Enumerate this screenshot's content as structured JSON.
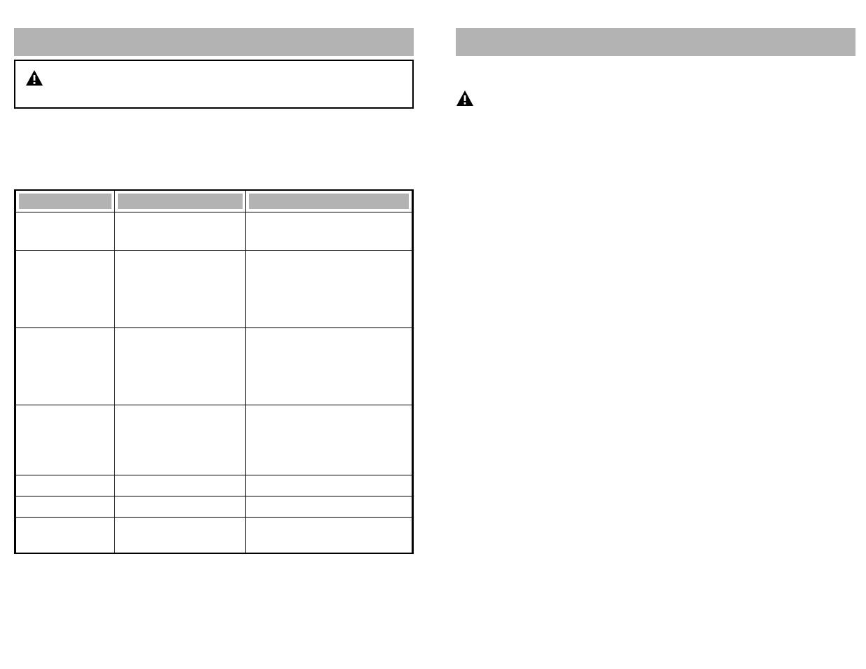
{
  "left": {
    "section_title": "",
    "warning_label": "",
    "warning_text": "",
    "intro_text": "",
    "table": {
      "headers": [
        "",
        "",
        ""
      ],
      "rows": [
        [
          "",
          "",
          ""
        ],
        [
          "",
          "",
          ""
        ],
        [
          "",
          "",
          ""
        ],
        [
          "",
          "",
          ""
        ],
        [
          "",
          "",
          ""
        ],
        [
          "",
          "",
          ""
        ],
        [
          "",
          "",
          ""
        ]
      ]
    }
  },
  "right": {
    "section_title": "",
    "warning_label": "",
    "warning_text": ""
  },
  "page_number": ""
}
